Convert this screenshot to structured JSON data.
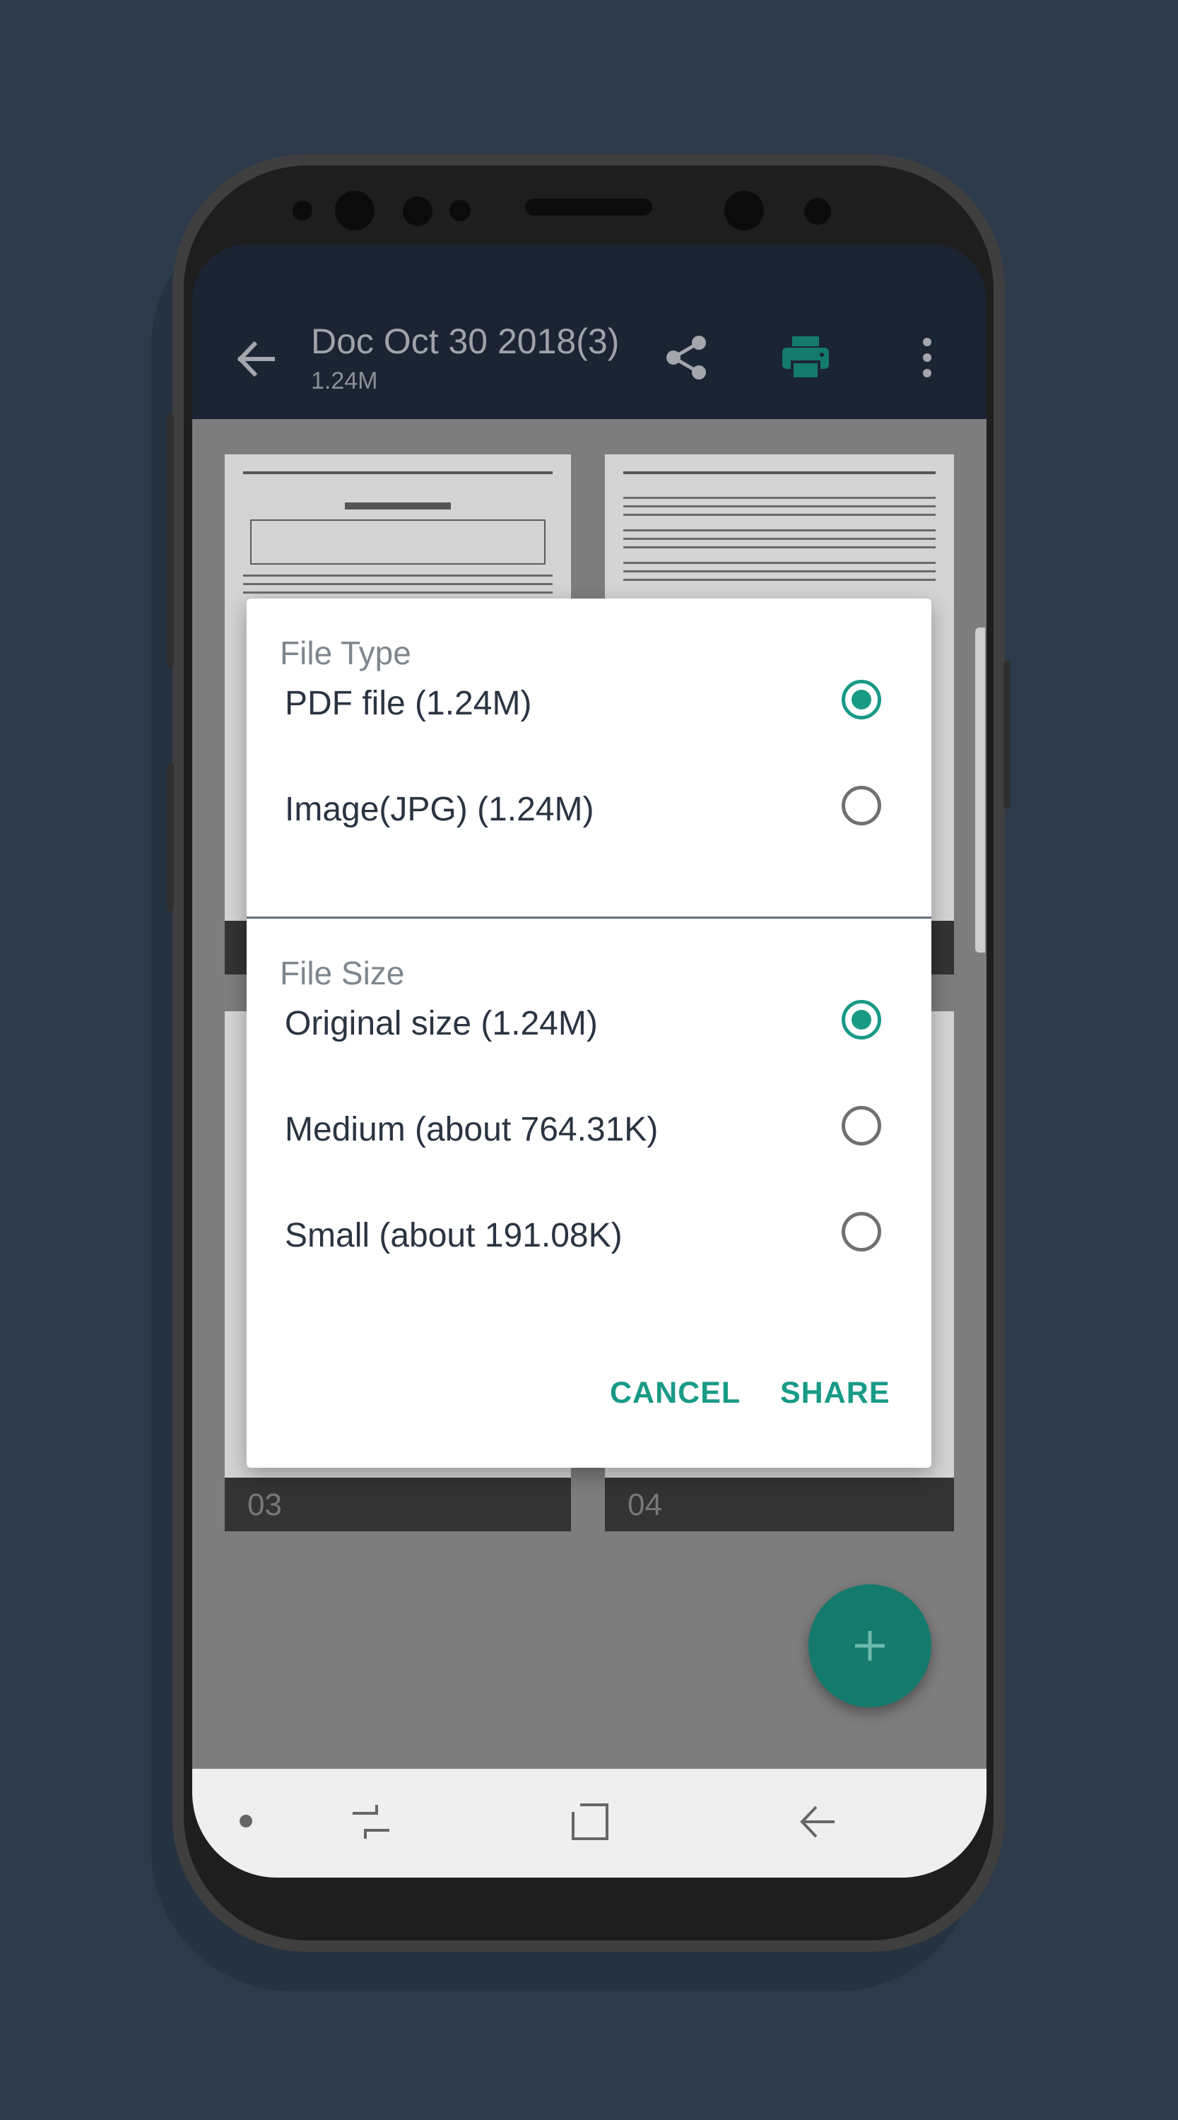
{
  "appbar": {
    "title": "Doc Oct 30 2018(3)",
    "subtitle": "1.24M",
    "icons": [
      "back-arrow-icon",
      "share-icon",
      "print-icon",
      "more-vert-icon"
    ]
  },
  "pages": [
    {
      "label": "03"
    },
    {
      "label": "04"
    }
  ],
  "fab": {
    "icon": "plus-icon",
    "glyph": "+"
  },
  "dialog": {
    "file_type_title": "File Type",
    "file_type_options": [
      {
        "label": "PDF file (1.24M)",
        "selected": true
      },
      {
        "label": "Image(JPG) (1.24M)",
        "selected": false
      }
    ],
    "file_size_title": "File Size",
    "file_size_options": [
      {
        "label": "Original size (1.24M)",
        "selected": true
      },
      {
        "label": "Medium (about 764.31K)",
        "selected": false
      },
      {
        "label": "Small (about 191.08K)",
        "selected": false
      }
    ],
    "cancel_label": "CANCEL",
    "share_label": "SHARE"
  },
  "navbar": {
    "icons": [
      "dot-icon",
      "recents-icon",
      "home-icon",
      "back-icon"
    ]
  },
  "colors": {
    "accent": "#189a86",
    "appbar": "#1a2433",
    "background": "#2c3a4b"
  }
}
